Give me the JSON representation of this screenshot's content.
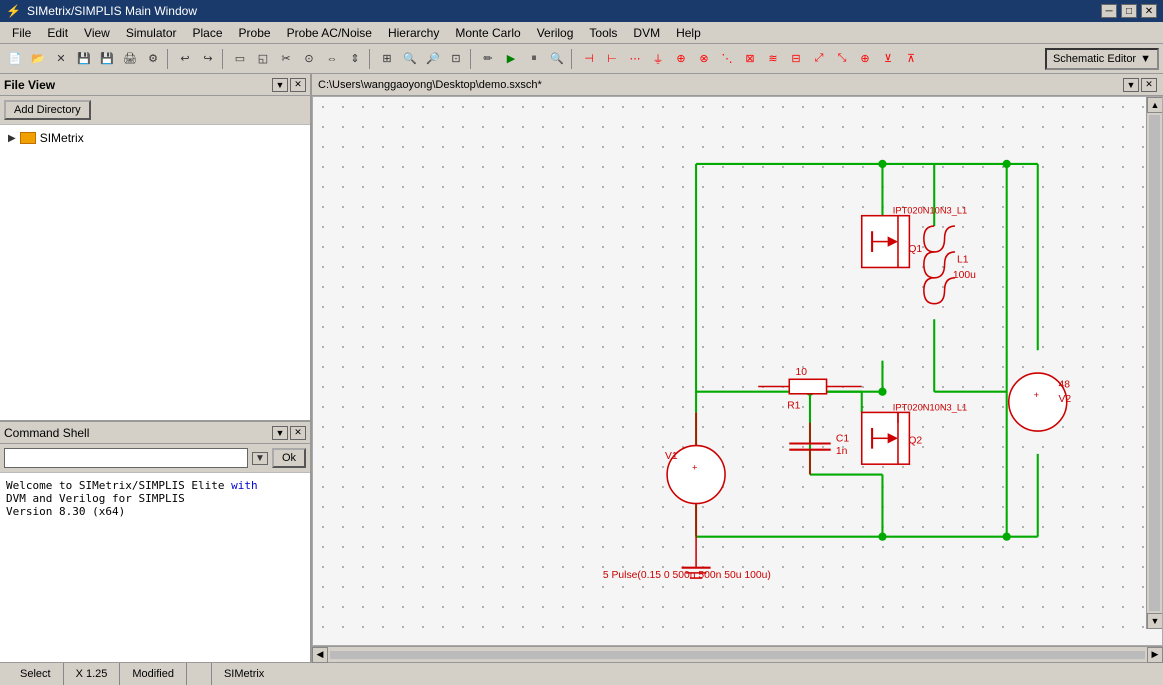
{
  "titlebar": {
    "title": "SIMetrix/SIMPLIS Main Window",
    "minimize_label": "─",
    "maximize_label": "□",
    "close_label": "✕"
  },
  "menubar": {
    "items": [
      "File",
      "Edit",
      "View",
      "Simulator",
      "Place",
      "Probe",
      "Probe AC/Noise",
      "Hierarchy",
      "Monte Carlo",
      "Verilog",
      "Tools",
      "DVM",
      "Help"
    ]
  },
  "toolbar": {
    "schematic_editor_label": "Schematic Editor"
  },
  "file_view": {
    "title": "File View",
    "add_dir_btn": "Add Directory",
    "tree": [
      {
        "label": "SIMetrix",
        "type": "folder",
        "expanded": false
      }
    ]
  },
  "cmd_shell": {
    "title": "Command Shell",
    "ok_label": "Ok",
    "input_placeholder": "",
    "output_lines": [
      {
        "text": "Welcome to SIMetrix/SIMPLIS Elite with",
        "color": "normal"
      },
      {
        "text": "DVM and Verilog for SIMPLIS",
        "color": "normal"
      },
      {
        "text": "Version 8.30 (x64)",
        "color": "normal"
      }
    ],
    "output_highlight": "with"
  },
  "schematic": {
    "path": "C:\\Users\\wanggaoyong\\Desktop\\demo.sxsch*",
    "components": {
      "mosfet1_label": "IPT020N10N3_L1",
      "mosfet1_ref": "Q1",
      "mosfet2_label": "IPT020N10N3_L1",
      "mosfet2_ref": "Q2",
      "inductor_label": "L1",
      "inductor_value": "100u",
      "cap_ref": "C1",
      "cap_value": "1n",
      "resistor_ref": "R1",
      "resistor_value": "10",
      "vsource1_ref": "V1",
      "vsource1_value": "5 Pulse(0.15 0 500n 500n 50u 100u)",
      "vsource2_ref": "V2",
      "vsource2_value": "48"
    }
  },
  "statusbar": {
    "select_label": "Select",
    "coordinates": "X 1.25",
    "modified_label": "Modified",
    "app_label": "SIMetrix"
  }
}
